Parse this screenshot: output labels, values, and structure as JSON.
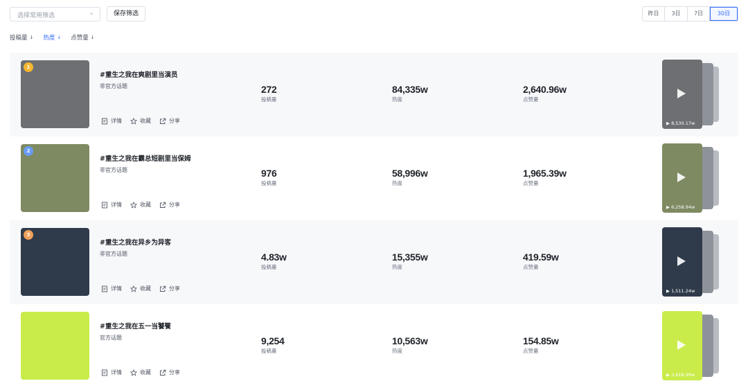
{
  "toolbar": {
    "filter_placeholder": "选择常用筛选",
    "save_label": "保存筛选",
    "ranges": [
      "昨日",
      "3日",
      "7日",
      "30日"
    ],
    "active_range": "30日"
  },
  "sort": {
    "items": [
      {
        "label": "投稿量"
      },
      {
        "label": "热度"
      },
      {
        "label": "点赞量"
      }
    ],
    "active": "热度"
  },
  "actions": {
    "detail": "详情",
    "favorite": "收藏",
    "share": "分享"
  },
  "topics": [
    {
      "rank": "1",
      "title": "#重生之我在爽剧里当演员",
      "type": "非官方话题",
      "posts": "272",
      "posts_label": "投稿量",
      "heat": "84,335w",
      "heat_label": "热度",
      "likes": "2,640.96w",
      "likes_label": "点赞量",
      "video_count": "8,530.17w",
      "thumb_color": "#6d6f73",
      "rank_color": "#f5b731"
    },
    {
      "rank": "2",
      "title": "#重生之我在霸总短剧里当保姆",
      "type": "非官方话题",
      "posts": "976",
      "posts_label": "投稿量",
      "heat": "58,996w",
      "heat_label": "热度",
      "likes": "1,965.39w",
      "likes_label": "点赞量",
      "video_count": "6,258.94w",
      "thumb_color": "#7e8a62",
      "rank_color": "#6a9cf7"
    },
    {
      "rank": "3",
      "title": "#重生之我在异乡为异客",
      "type": "非官方话题",
      "posts": "4.83w",
      "posts_label": "投稿量",
      "heat": "15,355w",
      "heat_label": "热度",
      "likes": "419.59w",
      "likes_label": "点赞量",
      "video_count": "1,511.24w",
      "thumb_color": "#2f3a4a",
      "rank_color": "#f0a05a"
    },
    {
      "rank": "",
      "title": "#重生之我在五一当饕餮",
      "type": "官方话题",
      "posts": "9,254",
      "posts_label": "投稿量",
      "heat": "10,563w",
      "heat_label": "热度",
      "likes": "154.85w",
      "likes_label": "点赞量",
      "video_count": "3,618.99w",
      "thumb_color": "#c9ec4a",
      "rank_color": ""
    }
  ]
}
